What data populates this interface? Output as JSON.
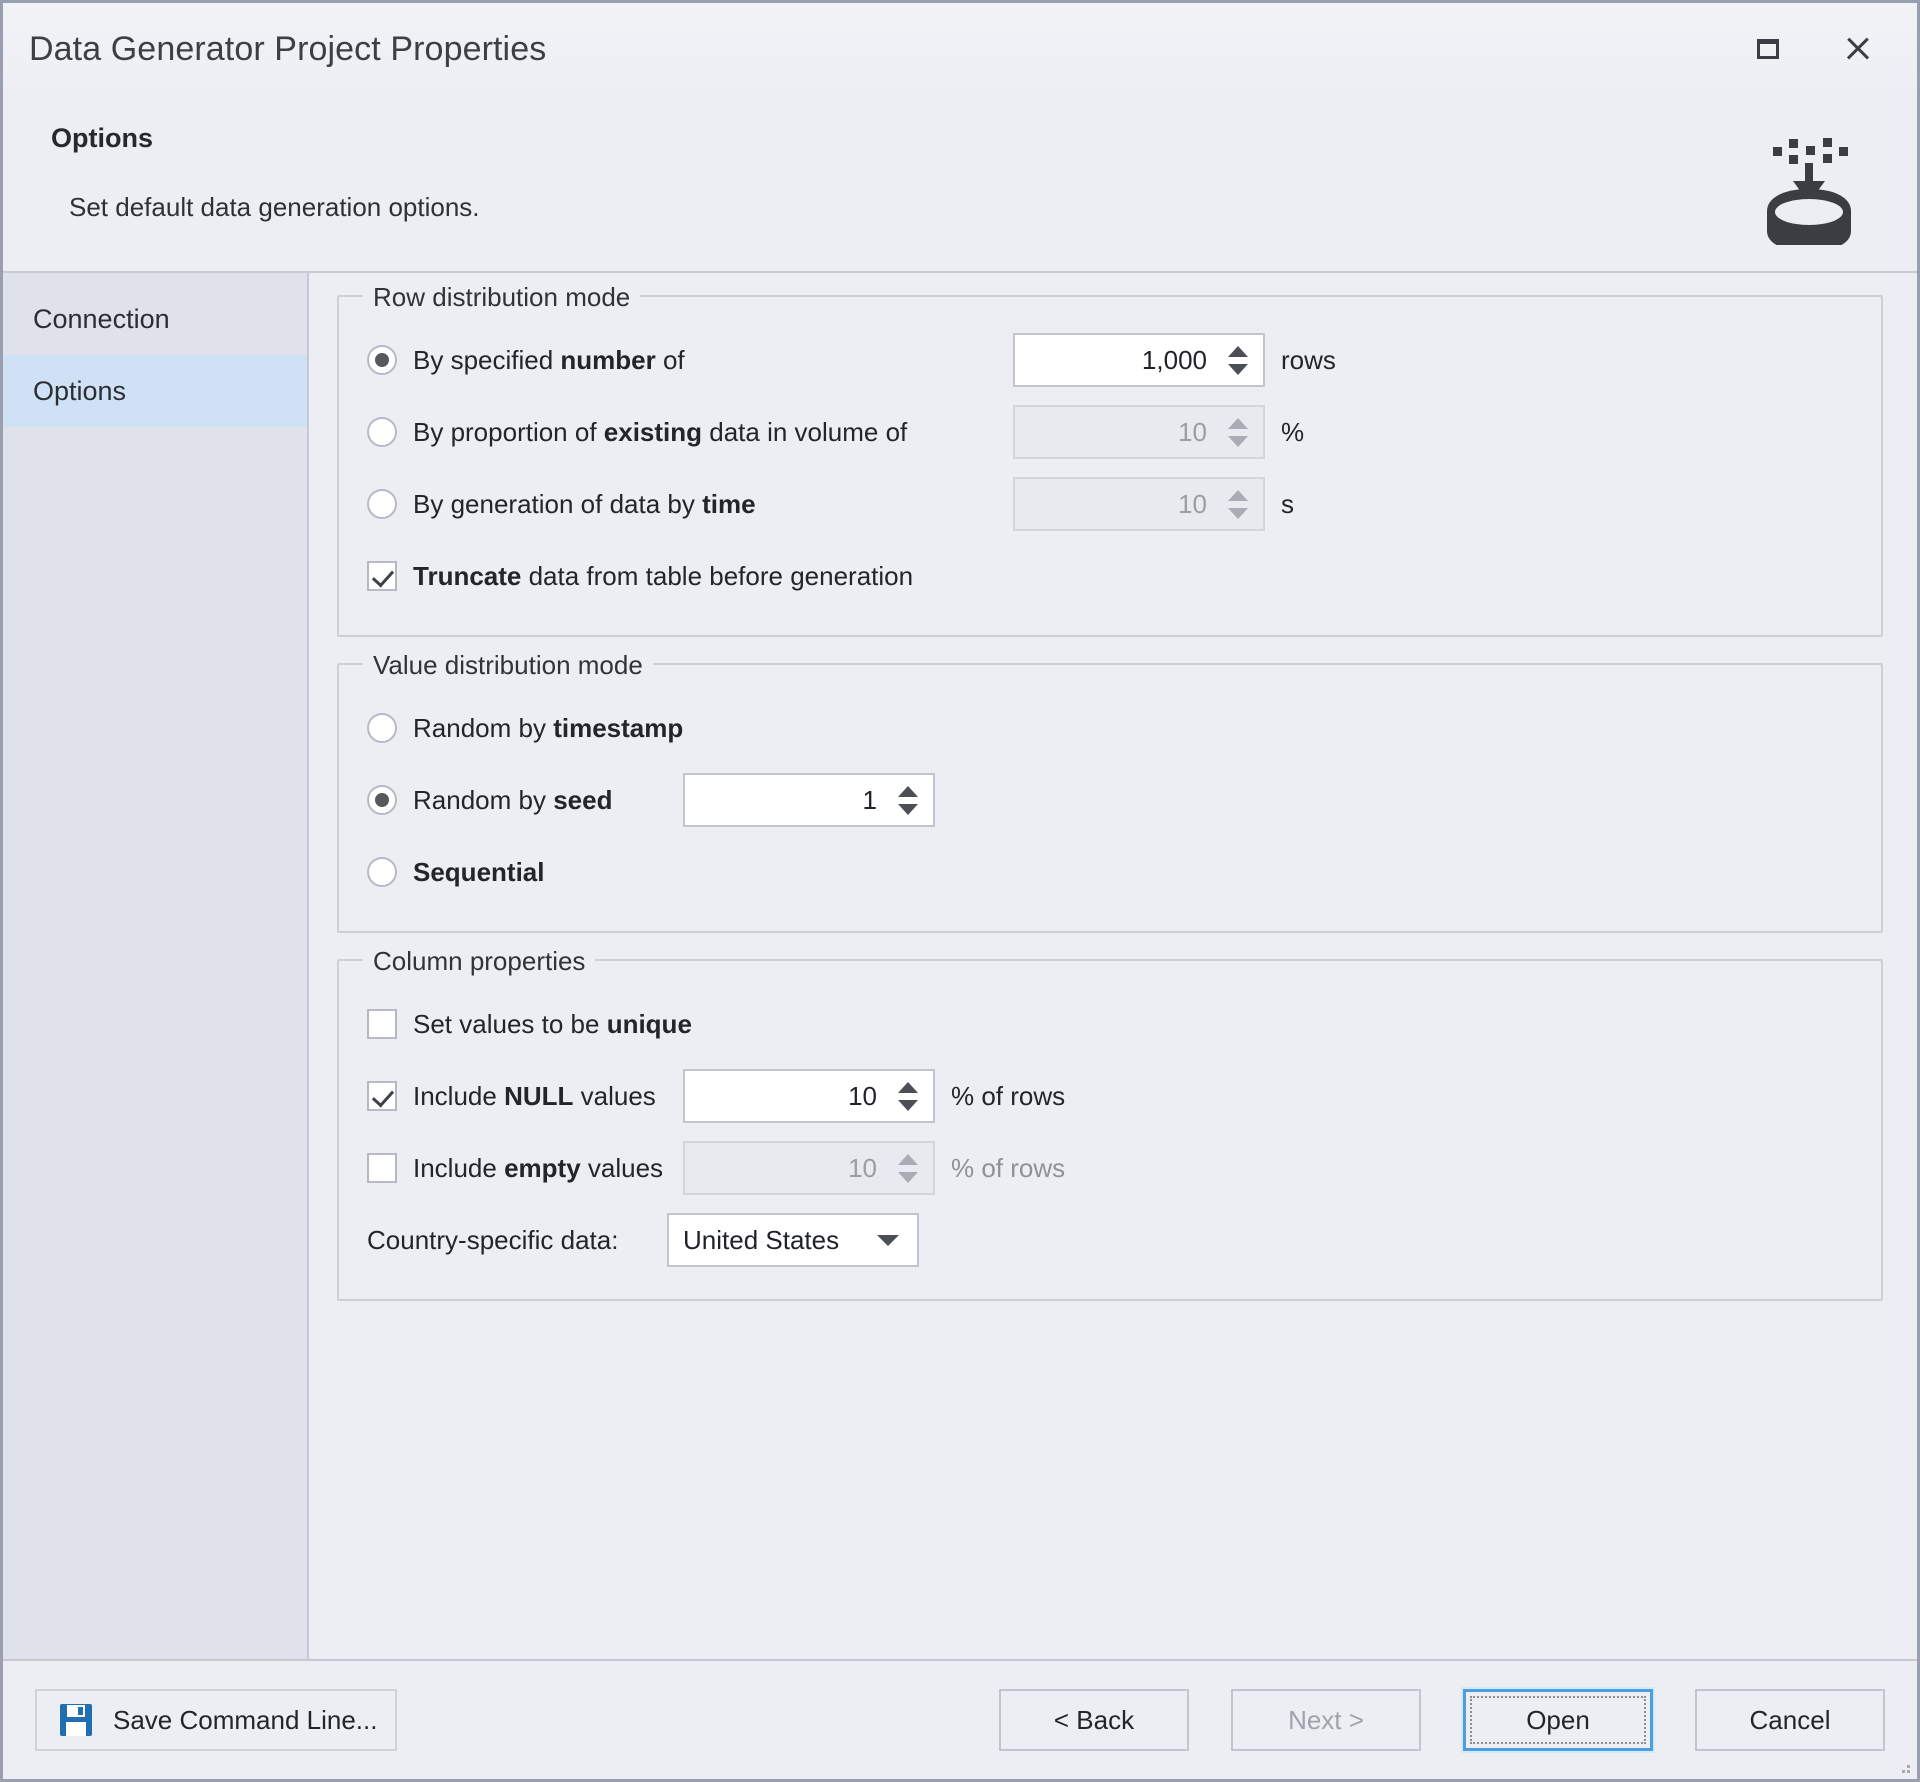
{
  "window": {
    "title": "Data Generator Project Properties",
    "maximize_icon": "maximize-icon",
    "close_icon": "close-icon"
  },
  "header": {
    "title": "Options",
    "subtitle": "Set default data generation options.",
    "icon": "data-generator-icon"
  },
  "sidebar": {
    "items": [
      {
        "label": "Connection",
        "active": false
      },
      {
        "label": "Options",
        "active": true
      }
    ],
    "active_highlight_color": "#cfe2f5"
  },
  "row_distribution": {
    "legend": "Row distribution mode",
    "options": [
      {
        "label_prefix": "By specified ",
        "label_bold": "number",
        "label_suffix": " of",
        "selected": true,
        "value": "1,000",
        "unit": "rows",
        "enabled": true
      },
      {
        "label_prefix": "By proportion of ",
        "label_bold": "existing",
        "label_suffix": " data in volume of",
        "selected": false,
        "value": "10",
        "unit": "%",
        "enabled": false
      },
      {
        "label_prefix": "By generation of data by ",
        "label_bold": "time",
        "label_suffix": "",
        "selected": false,
        "value": "10",
        "unit": "s",
        "enabled": false
      }
    ],
    "truncate": {
      "checked": true,
      "label_bold": "Truncate",
      "label_suffix": " data from table before generation"
    }
  },
  "value_distribution": {
    "legend": "Value distribution mode",
    "options": [
      {
        "label_prefix": "Random by ",
        "label_bold": "timestamp",
        "selected": false,
        "has_spin": false
      },
      {
        "label_prefix": "Random by ",
        "label_bold": "seed",
        "selected": true,
        "has_spin": true,
        "value": "1"
      },
      {
        "label_prefix": "",
        "label_bold": "Sequential",
        "selected": false,
        "has_spin": false
      }
    ]
  },
  "column_properties": {
    "legend": "Column properties",
    "unique": {
      "checked": false,
      "label_prefix": "Set values to be ",
      "label_bold": "unique"
    },
    "null_values": {
      "checked": true,
      "label_prefix": "Include ",
      "label_bold": "NULL",
      "label_suffix": " values",
      "value": "10",
      "unit": "% of rows",
      "enabled": true
    },
    "empty_values": {
      "checked": false,
      "label_prefix": "Include ",
      "label_bold": "empty",
      "label_suffix": " values",
      "value": "10",
      "unit": "% of rows",
      "enabled": false
    },
    "country": {
      "label": "Country-specific data:",
      "value": "United States"
    }
  },
  "footer": {
    "save_command_line": "Save Command Line...",
    "save_icon": "floppy-disk-icon",
    "back": "< Back",
    "next": "Next >",
    "open": "Open",
    "cancel": "Cancel",
    "next_enabled": false,
    "open_is_default": true
  },
  "colors": {
    "dialog_bg": "#eceef3",
    "sidebar_bg": "#dfe2ea",
    "selection_blue": "#cfe2f5",
    "default_button_border": "#4a9fe0",
    "save_icon_blue": "#1f6fb2"
  }
}
